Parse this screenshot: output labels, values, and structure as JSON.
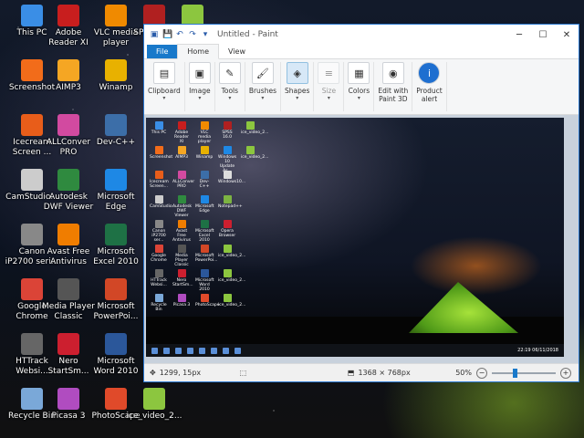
{
  "desktop": {
    "icons": [
      {
        "label": "This PC",
        "icon": "computer-icon",
        "color": "#3a8ee6"
      },
      {
        "label": "Adobe\nReader XI",
        "icon": "adobe-reader-icon",
        "color": "#c81e1e"
      },
      {
        "label": "VLC media\nplayer",
        "icon": "vlc-icon",
        "color": "#f08a00"
      },
      {
        "label": "SPSS 16.0",
        "icon": "spss-icon",
        "color": "#b02020"
      },
      {
        "label": "",
        "icon": "video-file-icon",
        "color": "#8cc63f"
      },
      {
        "label": "Screenshot",
        "icon": "screenshot-icon",
        "color": "#f26c1a"
      },
      {
        "label": "AIMP3",
        "icon": "aimp-icon",
        "color": "#f5a623"
      },
      {
        "label": "Winamp",
        "icon": "winamp-icon",
        "color": "#e8b100"
      },
      {
        "label": "Icecream\nScreen ...",
        "icon": "icecream-icon",
        "color": "#e85d1a"
      },
      {
        "label": "ALLConver\nPRO",
        "icon": "allconverter-icon",
        "color": "#d24aa0"
      },
      {
        "label": "Dev-C++",
        "icon": "devcpp-icon",
        "color": "#3c6ea8"
      },
      {
        "label": "CamStudio...",
        "icon": "camstudio-icon",
        "color": "#cccccc"
      },
      {
        "label": "Autodesk\nDWF Viewer",
        "icon": "autodesk-icon",
        "color": "#2f8a3f"
      },
      {
        "label": "Microsoft\nEdge",
        "icon": "edge-icon",
        "color": "#1e88e5"
      },
      {
        "label": "Canon\niP2700 seri...",
        "icon": "canon-icon",
        "color": "#888888"
      },
      {
        "label": "Avast Free\nAntivirus",
        "icon": "avast-icon",
        "color": "#f07d00"
      },
      {
        "label": "Microsoft\nExcel 2010",
        "icon": "excel-icon",
        "color": "#1e7145"
      },
      {
        "label": "Google\nChrome",
        "icon": "chrome-icon",
        "color": "#db4437"
      },
      {
        "label": "Media Player\nClassic",
        "icon": "media-player-icon",
        "color": "#555555"
      },
      {
        "label": "Microsoft\nPowerPoi...",
        "icon": "powerpoint-icon",
        "color": "#d24726"
      },
      {
        "label": "HTTrack\nWebsi...",
        "icon": "httrack-icon",
        "color": "#666666"
      },
      {
        "label": "Nero\nStartSm...",
        "icon": "nero-icon",
        "color": "#cc1f2f"
      },
      {
        "label": "Microsoft\nWord 2010",
        "icon": "word-icon",
        "color": "#2b579a"
      },
      {
        "label": "Recycle Bin",
        "icon": "recycle-bin-icon",
        "color": "#7aa8d8"
      },
      {
        "label": "Picasa 3",
        "icon": "picasa-icon",
        "color": "#b04cc0"
      },
      {
        "label": "PhotoScape",
        "icon": "photoscape-icon",
        "color": "#e04a2a"
      },
      {
        "label": "ice_video_2...",
        "icon": "video-file-icon",
        "color": "#8cc63f"
      }
    ]
  },
  "window": {
    "title": "Untitled - Paint",
    "tabs": {
      "file": "File",
      "home": "Home",
      "view": "View"
    },
    "ribbon": [
      {
        "label": "Clipboard",
        "icon": "clipboard-icon",
        "glyph": "▤"
      },
      {
        "label": "Image",
        "icon": "image-icon",
        "glyph": "▣"
      },
      {
        "label": "Tools",
        "icon": "tools-icon",
        "glyph": "✎"
      },
      {
        "label": "Brushes",
        "icon": "brush-icon",
        "glyph": "🖌"
      },
      {
        "label": "Shapes",
        "icon": "shapes-icon",
        "glyph": "◈"
      },
      {
        "label": "Size",
        "icon": "size-icon",
        "glyph": "≡"
      },
      {
        "label": "Colors",
        "icon": "colors-icon",
        "glyph": "▦"
      },
      {
        "label": "Edit with\nPaint 3D",
        "icon": "paint3d-icon",
        "glyph": "◉"
      },
      {
        "label": "Product\nalert",
        "icon": "info-icon",
        "glyph": "i"
      }
    ],
    "status": {
      "cursor": "1299, 15px",
      "dimensions": "1368 × 768px",
      "zoom": "50%"
    }
  },
  "mini": {
    "labels": [
      "This PC",
      "Adobe\nReader XI",
      "VLC media\nplayer",
      "SPSS 16.0",
      "ice_video_2...",
      "Screenshot",
      "AIMP3",
      "Winamp",
      "Windows 10\nUpdate As...",
      "ice_video_2...",
      "Icecream\nScreen...",
      "ALLConver\nPRO",
      "Dev-C++",
      "Windows10...",
      "CamStudio...",
      "Autodesk\nDWF Viewer",
      "Microsoft\nEdge",
      "Notepad++",
      "Canon\niP2700 ser...",
      "Avast Free\nAntivirus",
      "Microsoft\nExcel 2010",
      "Opera\nBrowser",
      "Google\nChrome",
      "Media Player\nClassic",
      "Microsoft\nPowerPoi...",
      "ice_video_2...",
      "HTTrack\nWebsi...",
      "Nero\nStartSm...",
      "Microsoft\nWord 2010",
      "ice_video_2...",
      "Recycle Bin",
      "Picasa 3",
      "PhotoScape",
      "ice_video_2..."
    ],
    "clock": "22:19\n06/11/2018"
  }
}
